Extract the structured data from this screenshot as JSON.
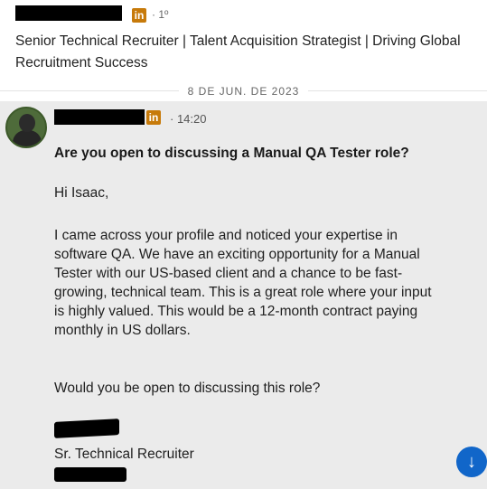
{
  "previous_message": {
    "linkedin_badge": "in",
    "degree": "· 1º",
    "headline": "Senior Technical Recruiter | Talent Acquisition Strategist | Driving Global Recruitment Success"
  },
  "date_separator": "8 DE JUN. DE 2023",
  "message": {
    "linkedin_badge": "in",
    "time": "· 14:20",
    "subject": "Are you open to discussing a Manual QA Tester role?",
    "greeting": "Hi Isaac,",
    "paragraph": "I came across your profile and noticed your expertise in software QA. We have an exciting opportunity for a Manual Tester with our US-based client and a chance to be fast-growing, technical team. This is a great role where your input is highly valued. This would be a 12-month contract paying monthly in US dollars.",
    "question": "Would you be open to discussing this role?",
    "signature_title": "Sr. Technical Recruiter"
  },
  "scroll_button": {
    "icon": "↓"
  },
  "colors": {
    "linkedin_badge": "#c77a0a",
    "message_bg": "#ebebeb",
    "scroll_button": "#1166c9"
  }
}
